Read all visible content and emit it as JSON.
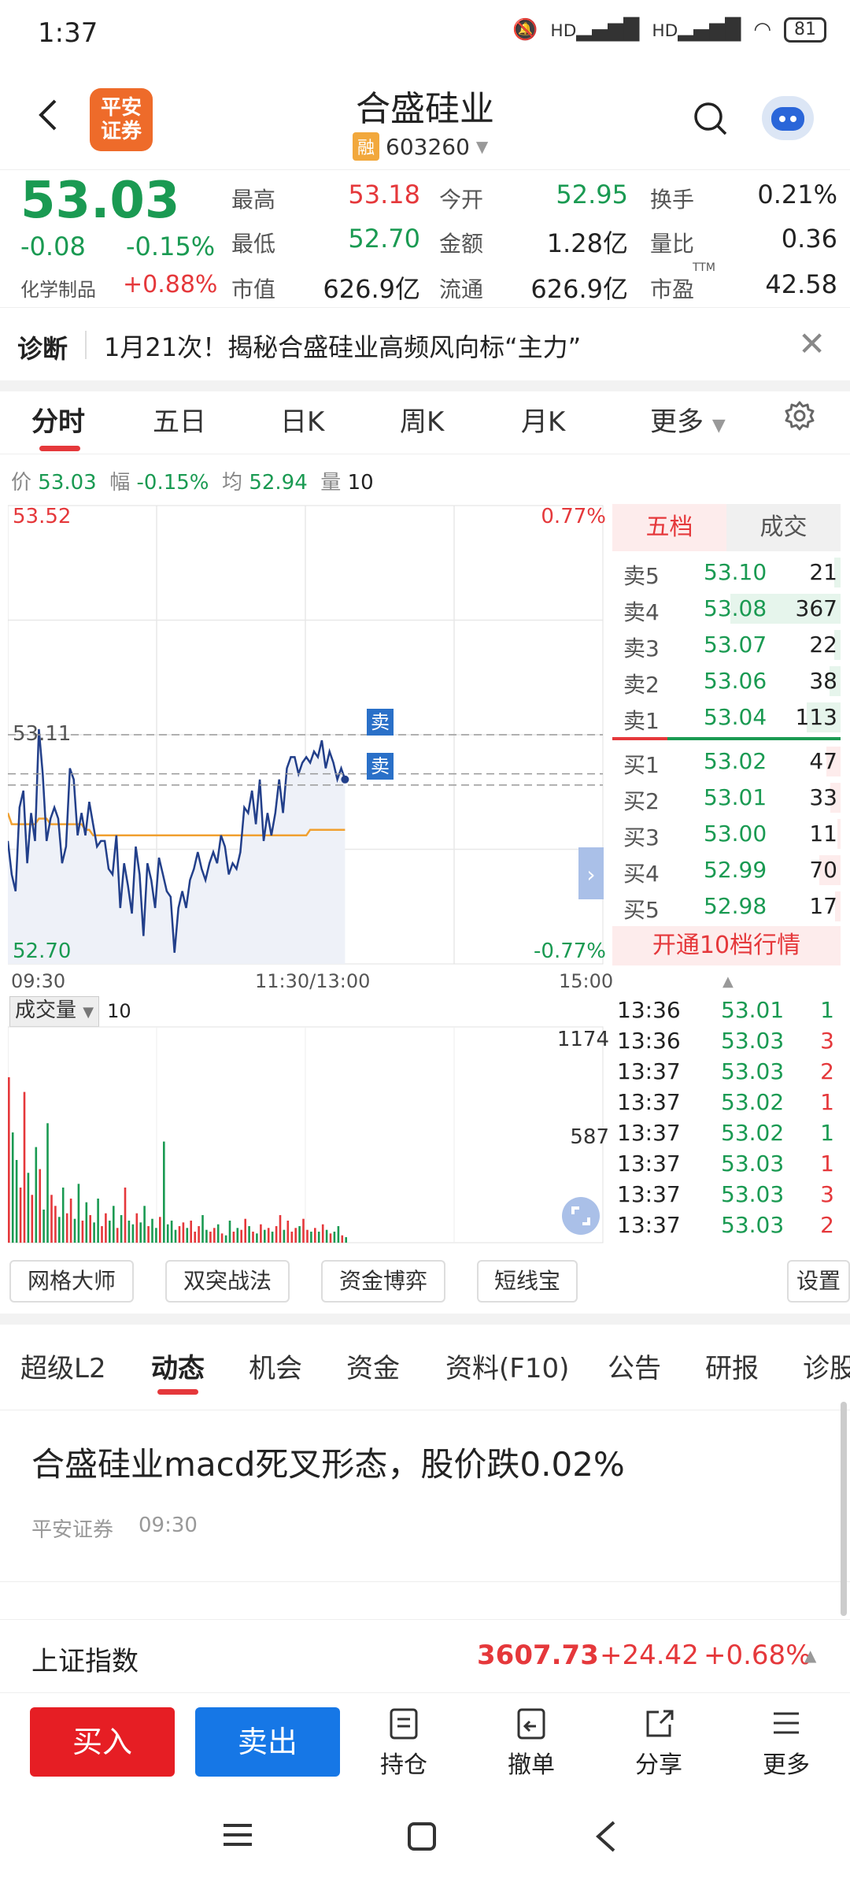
{
  "status_bar": {
    "time": "1:37",
    "net1": "HD",
    "net2": "HD",
    "battery": "81"
  },
  "header": {
    "logo_line1": "平安",
    "logo_line2": "证券",
    "stock_name": "合盛硅业",
    "margin_badge": "融",
    "stock_code": "603260"
  },
  "quote": {
    "price": "53.03",
    "change": "-0.08",
    "change_pct": "-0.15%",
    "sector": "化学制品",
    "sector_pct": "+0.88%",
    "high_label": "最高",
    "high": "53.18",
    "low_label": "最低",
    "low": "52.70",
    "mktcap_label": "市值",
    "mktcap": "626.9亿",
    "open_label": "今开",
    "open": "52.95",
    "amount_label": "金额",
    "amount": "1.28亿",
    "float_label": "流通",
    "float": "626.9亿",
    "turnover_label": "换手",
    "turnover": "0.21%",
    "volratio_label": "量比",
    "volratio": "0.36",
    "pe_label": "市盈",
    "pe_sup": "TTM",
    "pe": "42.58"
  },
  "diagnosis": {
    "label": "诊断",
    "text": "1月21次！揭秘合盛硅业高频风向标“主力”"
  },
  "chart_tabs": [
    "分时",
    "五日",
    "日K",
    "周K",
    "月K",
    "更多"
  ],
  "price_line": {
    "price_label": "价",
    "price": "53.03",
    "amp_label": "幅",
    "amp": "-0.15%",
    "avg_label": "均",
    "avg": "52.94",
    "vol_label": "量",
    "vol": "10"
  },
  "chart": {
    "y_high": "53.52",
    "y_high_pct": "0.77%",
    "y_mid": "53.11",
    "y_low": "52.70",
    "y_low_pct": "-0.77%",
    "t_start": "09:30",
    "t_mid": "11:30/13:00",
    "t_end": "15:00",
    "sell_marker": "卖",
    "volume_label": "成交量",
    "volume_value": "10",
    "vol_max": "1174",
    "vol_mid": "587"
  },
  "chart_data": {
    "type": "line",
    "series": [
      {
        "values": [
          52.92,
          52.86,
          52.83,
          52.98,
          53.01,
          52.88,
          52.97,
          52.92,
          53.12,
          53.04,
          52.92,
          52.96,
          52.98,
          52.96,
          52.88,
          52.91,
          53.05,
          53.03,
          52.93,
          52.97,
          52.93,
          52.99,
          52.95,
          52.91,
          52.92,
          52.92,
          52.87,
          52.86,
          52.93,
          52.8,
          52.88,
          52.84,
          52.79,
          52.91,
          52.86,
          52.75,
          52.88,
          52.85,
          52.8,
          52.89,
          52.86,
          52.83,
          52.82,
          52.72,
          52.8,
          52.83,
          52.8,
          52.85,
          52.87,
          52.9,
          52.87,
          52.85,
          52.88,
          52.9,
          52.88,
          52.93,
          52.91,
          52.86,
          52.88,
          52.87,
          52.9,
          52.98,
          52.97,
          53.01,
          52.95,
          53.03,
          52.92,
          52.97,
          52.93,
          52.97,
          53.03,
          52.97,
          53.05,
          53.07,
          53.07,
          53.04,
          53.06,
          53.07,
          53.06,
          53.08,
          53.07,
          53.1,
          53.05,
          53.08,
          53.06,
          53.03,
          53.05,
          53.03
        ]
      },
      {
        "values": [
          52.97,
          52.95,
          52.95,
          52.95,
          52.95,
          52.95,
          52.95,
          52.95,
          52.96,
          52.96,
          52.96,
          52.95,
          52.95,
          52.95,
          52.95,
          52.95,
          52.95,
          52.95,
          52.95,
          52.95,
          52.94,
          52.94,
          52.93,
          52.93,
          52.93,
          52.93,
          52.93,
          52.93,
          52.93,
          52.93,
          52.93,
          52.93,
          52.93,
          52.93,
          52.93,
          52.93,
          52.93,
          52.93,
          52.93,
          52.93,
          52.93,
          52.93,
          52.93,
          52.93,
          52.93,
          52.93,
          52.93,
          52.93,
          52.93,
          52.93,
          52.93,
          52.93,
          52.93,
          52.93,
          52.93,
          52.93,
          52.93,
          52.93,
          52.93,
          52.93,
          52.93,
          52.93,
          52.93,
          52.93,
          52.93,
          52.93,
          52.93,
          52.93,
          52.93,
          52.93,
          52.93,
          52.93,
          52.93,
          52.93,
          52.93,
          52.93,
          52.93,
          52.93,
          52.94,
          52.94,
          52.94,
          52.94,
          52.94,
          52.94,
          52.94,
          52.94,
          52.94,
          52.94
        ]
      }
    ],
    "ylim": [
      52.7,
      53.52
    ],
    "grid": true,
    "volumes": [
      900,
      600,
      450,
      300,
      820,
      380,
      260,
      520,
      400,
      180,
      650,
      260,
      200,
      140,
      300,
      160,
      240,
      130,
      320,
      120,
      220,
      150,
      110,
      240,
      90,
      160,
      120,
      200,
      80,
      150,
      300,
      120,
      100,
      160,
      110,
      200,
      90,
      130,
      80,
      140,
      550,
      100,
      120,
      70,
      90,
      110,
      80,
      120,
      60,
      90,
      150,
      70,
      60,
      80,
      100,
      50,
      40,
      120,
      60,
      80,
      70,
      130,
      90,
      60,
      50,
      100,
      70,
      80,
      60,
      90,
      150,
      70,
      120,
      60,
      80,
      90,
      130,
      70,
      60,
      80,
      60,
      100,
      70,
      50,
      60,
      90,
      40,
      30
    ]
  },
  "order_book": {
    "tab_book": "五档",
    "tab_trades": "成交",
    "asks": [
      {
        "label": "卖5",
        "price": "53.10",
        "vol": "21",
        "weight": 0.06
      },
      {
        "label": "卖4",
        "price": "53.08",
        "vol": "367",
        "weight": 1.0
      },
      {
        "label": "卖3",
        "price": "53.07",
        "vol": "22",
        "weight": 0.06
      },
      {
        "label": "卖2",
        "price": "53.06",
        "vol": "38",
        "weight": 0.1
      },
      {
        "label": "卖1",
        "price": "53.04",
        "vol": "113",
        "weight": 0.31
      }
    ],
    "bids": [
      {
        "label": "买1",
        "price": "53.02",
        "vol": "47",
        "weight": 0.13
      },
      {
        "label": "买2",
        "price": "53.01",
        "vol": "33",
        "weight": 0.09
      },
      {
        "label": "买3",
        "price": "53.00",
        "vol": "11",
        "weight": 0.03
      },
      {
        "label": "买4",
        "price": "52.99",
        "vol": "70",
        "weight": 0.19
      },
      {
        "label": "买5",
        "price": "52.98",
        "vol": "17",
        "weight": 0.05
      }
    ],
    "open_10": "开通10档行情"
  },
  "trades": [
    {
      "time": "13:36",
      "price": "53.01",
      "vol": "1",
      "side": "buy"
    },
    {
      "time": "13:36",
      "price": "53.03",
      "vol": "3",
      "side": "sell"
    },
    {
      "time": "13:37",
      "price": "53.03",
      "vol": "2",
      "side": "sell"
    },
    {
      "time": "13:37",
      "price": "53.02",
      "vol": "1",
      "side": "sell"
    },
    {
      "time": "13:37",
      "price": "53.02",
      "vol": "1",
      "side": "buy"
    },
    {
      "time": "13:37",
      "price": "53.03",
      "vol": "1",
      "side": "sell"
    },
    {
      "time": "13:37",
      "price": "53.03",
      "vol": "3",
      "side": "sell"
    },
    {
      "time": "13:37",
      "price": "53.03",
      "vol": "2",
      "side": "sell"
    }
  ],
  "tools": [
    "网格大师",
    "双突战法",
    "资金博弈",
    "短线宝",
    "设置"
  ],
  "info_tabs": [
    "超级L2",
    "动态",
    "机会",
    "资金",
    "资料(F10)",
    "公告",
    "研报",
    "诊股"
  ],
  "news": {
    "title": "合盛硅业macd死叉形态，股价跌0.02%",
    "source": "平安证券",
    "time": "09:30"
  },
  "index_bar": {
    "name": "上证指数",
    "value": "3607.73",
    "change": "+24.42",
    "pct": "+0.68%"
  },
  "actions": {
    "buy": "买入",
    "sell": "卖出",
    "hold": "持仓",
    "cancel": "撤单",
    "share": "分享",
    "more": "更多"
  },
  "colors": {
    "up": "#e5383b",
    "down": "#1a9a52",
    "price_line": "#223f8a",
    "avg_line": "#f0a030",
    "buy_btn": "#e61e24",
    "sell_btn": "#1677e6"
  }
}
